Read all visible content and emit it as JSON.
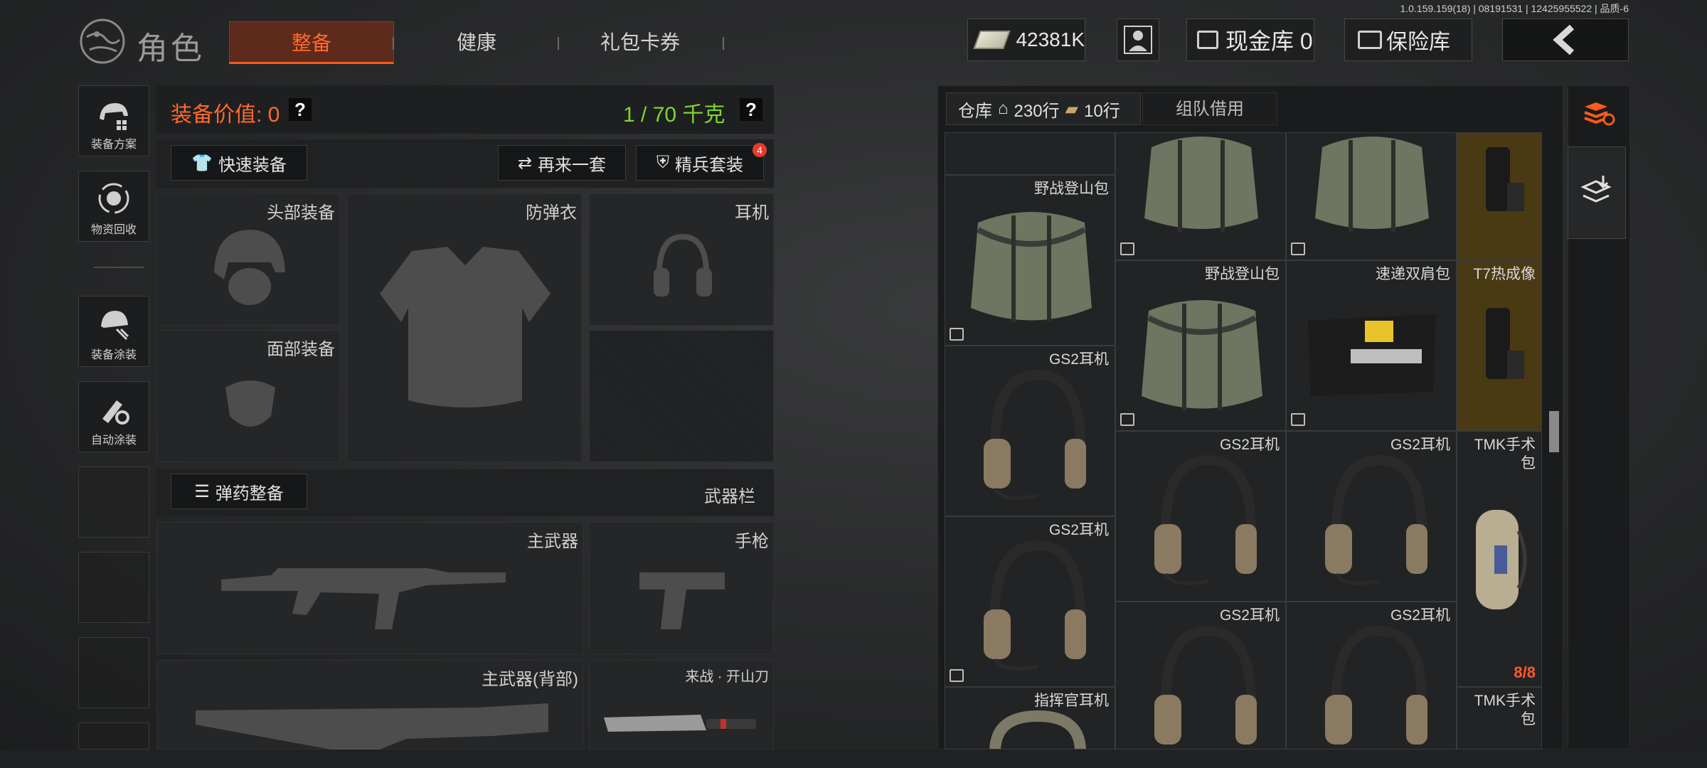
{
  "version": "1.0.159.159(18) | 08191531 | 12425955522 | 品质-6",
  "header": {
    "title": "角色",
    "tabs": [
      {
        "label": "整备",
        "active": true
      },
      {
        "label": "健康",
        "active": false
      },
      {
        "label": "礼包卡券",
        "active": false
      }
    ],
    "currency": "42381K",
    "cash_label": "现金库 0",
    "vault_label": "保险库"
  },
  "sidebar": {
    "items": [
      {
        "label": "装备方案",
        "icon": "helmet-grid-icon"
      },
      {
        "label": "物资回收",
        "icon": "recycle-icon"
      },
      {
        "label": "装备涂装",
        "icon": "helmet-paint-icon"
      },
      {
        "label": "自动涂装",
        "icon": "brush-gear-icon"
      }
    ]
  },
  "equip": {
    "value_label": "装备价值: 0",
    "weight": "1 / 70 千克",
    "help": "?",
    "quick_equip": "快速装备",
    "again": "再来一套",
    "elite": "精兵套装",
    "elite_badge": "4",
    "slots": {
      "head": "头部装备",
      "armor": "防弹衣",
      "headset": "耳机",
      "face": "面部装备",
      "primary": "主武器",
      "pistol": "手枪",
      "primary_back": "主武器(背部)",
      "melee": "来战 · 开山刀"
    },
    "ammo": "弹药整备",
    "weapon_col": "武器栏"
  },
  "warehouse": {
    "label": "仓库",
    "rows_home": "230行",
    "rows_bag": "10行",
    "team_tab": "组队借用",
    "items": {
      "bag": "野战登山包",
      "courier": "速递双肩包",
      "thermal": "T7热成像",
      "gs2": "GS2耳机",
      "tmk": "TMK手术包",
      "commander": "指挥官耳机",
      "tmk_count": "8/8"
    }
  },
  "colors": {
    "accent": "#ff6a2b",
    "weight_green": "#7fd62c",
    "badge_red": "#e83b2d",
    "gold_cell": "#4a3a14"
  }
}
